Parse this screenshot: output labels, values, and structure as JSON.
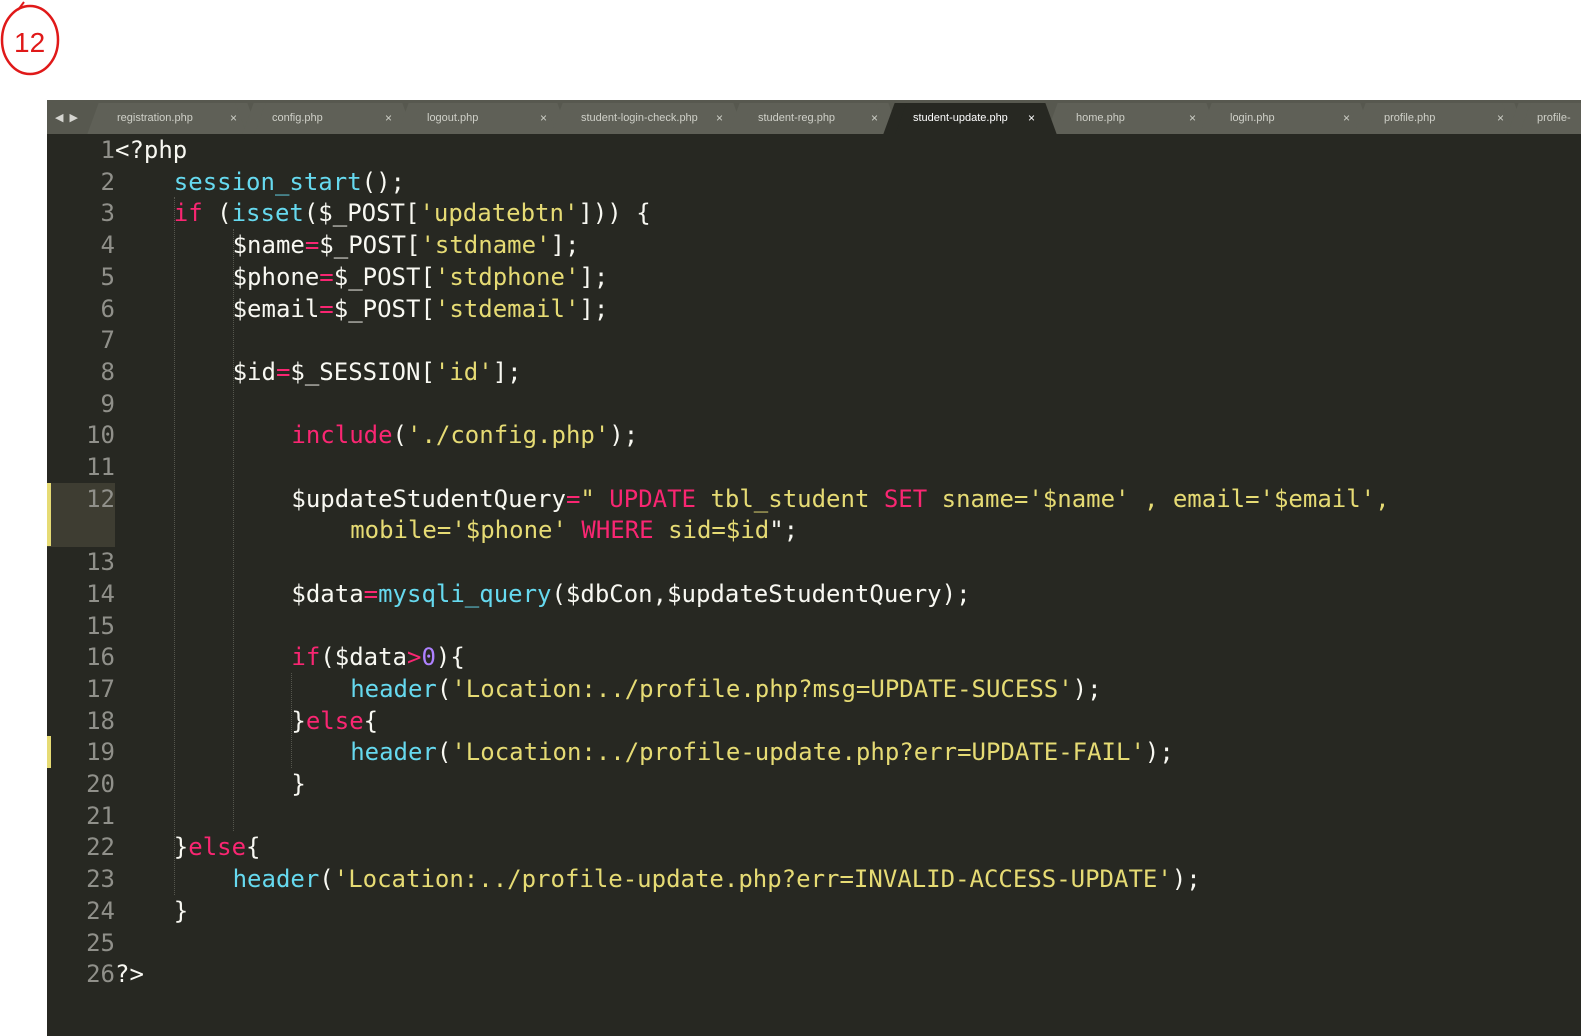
{
  "annotation": {
    "text": "12"
  },
  "tabs": [
    {
      "label": "registration.php",
      "close": "×",
      "active": false
    },
    {
      "label": "config.php",
      "close": "×",
      "active": false
    },
    {
      "label": "logout.php",
      "close": "×",
      "active": false
    },
    {
      "label": "student-login-check.php",
      "close": "×",
      "active": false
    },
    {
      "label": "student-reg.php",
      "close": "×",
      "active": false
    },
    {
      "label": "student-update.php",
      "close": "×",
      "active": true
    },
    {
      "label": "home.php",
      "close": "×",
      "active": false
    },
    {
      "label": "login.php",
      "close": "×",
      "active": false
    },
    {
      "label": "profile.php",
      "close": "×",
      "active": false
    },
    {
      "label": "profile-",
      "close": "",
      "active": false
    }
  ],
  "colors": {
    "background": "#272822",
    "default": "#f8f8f2",
    "function": "#66d9ef",
    "keyword": "#f92672",
    "string": "#e6db74",
    "number": "#ae81ff",
    "line_number": "#90908a",
    "modified_marker": "#e6db74"
  },
  "editor": {
    "active_line": "12",
    "lines": [
      {
        "n": "1",
        "tokens": [
          [
            "def",
            "<?php"
          ]
        ]
      },
      {
        "n": "2",
        "tokens": [
          [
            "fn",
            "session_start"
          ],
          [
            "def",
            "();"
          ]
        ]
      },
      {
        "n": "3",
        "tokens": [
          [
            "kw",
            "if"
          ],
          [
            "def",
            " ("
          ],
          [
            "fn",
            "isset"
          ],
          [
            "def",
            "($_POST["
          ],
          [
            "str",
            "'updatebtn'"
          ],
          [
            "def",
            "])) {"
          ]
        ]
      },
      {
        "n": "4",
        "tokens": [
          [
            "def",
            "$name"
          ],
          [
            "kw",
            "="
          ],
          [
            "def",
            "$_POST["
          ],
          [
            "str",
            "'stdname'"
          ],
          [
            "def",
            "];"
          ]
        ]
      },
      {
        "n": "5",
        "tokens": [
          [
            "def",
            "$phone"
          ],
          [
            "kw",
            "="
          ],
          [
            "def",
            "$_POST["
          ],
          [
            "str",
            "'stdphone'"
          ],
          [
            "def",
            "];"
          ]
        ]
      },
      {
        "n": "6",
        "tokens": [
          [
            "def",
            "$email"
          ],
          [
            "kw",
            "="
          ],
          [
            "def",
            "$_POST["
          ],
          [
            "str",
            "'stdemail'"
          ],
          [
            "def",
            "];"
          ]
        ]
      },
      {
        "n": "7",
        "tokens": []
      },
      {
        "n": "8",
        "tokens": [
          [
            "def",
            "$id"
          ],
          [
            "kw",
            "="
          ],
          [
            "def",
            "$_SESSION["
          ],
          [
            "str",
            "'id'"
          ],
          [
            "def",
            "];"
          ]
        ]
      },
      {
        "n": "9",
        "tokens": []
      },
      {
        "n": "10",
        "tokens": [
          [
            "kw",
            "include"
          ],
          [
            "def",
            "("
          ],
          [
            "str",
            "'./config.php'"
          ],
          [
            "def",
            ");"
          ]
        ]
      },
      {
        "n": "11",
        "tokens": []
      },
      {
        "n": "12",
        "tokens": [
          [
            "def",
            "$updateStudentQuery"
          ],
          [
            "kw",
            "="
          ],
          [
            "str",
            "\" "
          ],
          [
            "kw",
            "UPDATE"
          ],
          [
            "str",
            " tbl_student "
          ],
          [
            "kw",
            "SET"
          ],
          [
            "str",
            " sname='$name' , email='$email',"
          ]
        ]
      },
      {
        "n": "",
        "tokens": [
          [
            "str",
            "mobile='$phone' "
          ],
          [
            "kw",
            "WHERE"
          ],
          [
            "str",
            " sid=$id"
          ],
          [
            "def",
            "\";"
          ]
        ]
      },
      {
        "n": "13",
        "tokens": []
      },
      {
        "n": "14",
        "tokens": [
          [
            "def",
            "$data"
          ],
          [
            "kw",
            "="
          ],
          [
            "fn",
            "mysqli_query"
          ],
          [
            "def",
            "($dbCon,$updateStudentQuery);"
          ]
        ]
      },
      {
        "n": "15",
        "tokens": []
      },
      {
        "n": "16",
        "tokens": [
          [
            "kw",
            "if"
          ],
          [
            "def",
            "($data"
          ],
          [
            "kw",
            ">"
          ],
          [
            "num",
            "0"
          ],
          [
            "def",
            "){"
          ]
        ]
      },
      {
        "n": "17",
        "tokens": [
          [
            "fn",
            "header"
          ],
          [
            "def",
            "("
          ],
          [
            "str",
            "'Location:../profile.php?msg=UPDATE-SUCESS'"
          ],
          [
            "def",
            ");"
          ]
        ]
      },
      {
        "n": "18",
        "tokens": [
          [
            "def",
            "}"
          ],
          [
            "kw",
            "else"
          ],
          [
            "def",
            "{"
          ]
        ]
      },
      {
        "n": "19",
        "tokens": [
          [
            "fn",
            "header"
          ],
          [
            "def",
            "("
          ],
          [
            "str",
            "'Location:../profile-update.php?err=UPDATE-FAIL'"
          ],
          [
            "def",
            ");"
          ]
        ]
      },
      {
        "n": "20",
        "tokens": [
          [
            "def",
            "}"
          ]
        ]
      },
      {
        "n": "21",
        "tokens": []
      },
      {
        "n": "22",
        "tokens": [
          [
            "def",
            "}"
          ],
          [
            "kw",
            "else"
          ],
          [
            "def",
            "{"
          ]
        ]
      },
      {
        "n": "23",
        "tokens": [
          [
            "fn",
            "header"
          ],
          [
            "def",
            "("
          ],
          [
            "str",
            "'Location:../profile-update.php?err=INVALID-ACCESS-UPDATE'"
          ],
          [
            "def",
            ");"
          ]
        ]
      },
      {
        "n": "24",
        "tokens": [
          [
            "def",
            "}"
          ]
        ]
      },
      {
        "n": "25",
        "tokens": []
      },
      {
        "n": "26",
        "tokens": [
          [
            "def",
            "?>"
          ]
        ]
      }
    ]
  }
}
